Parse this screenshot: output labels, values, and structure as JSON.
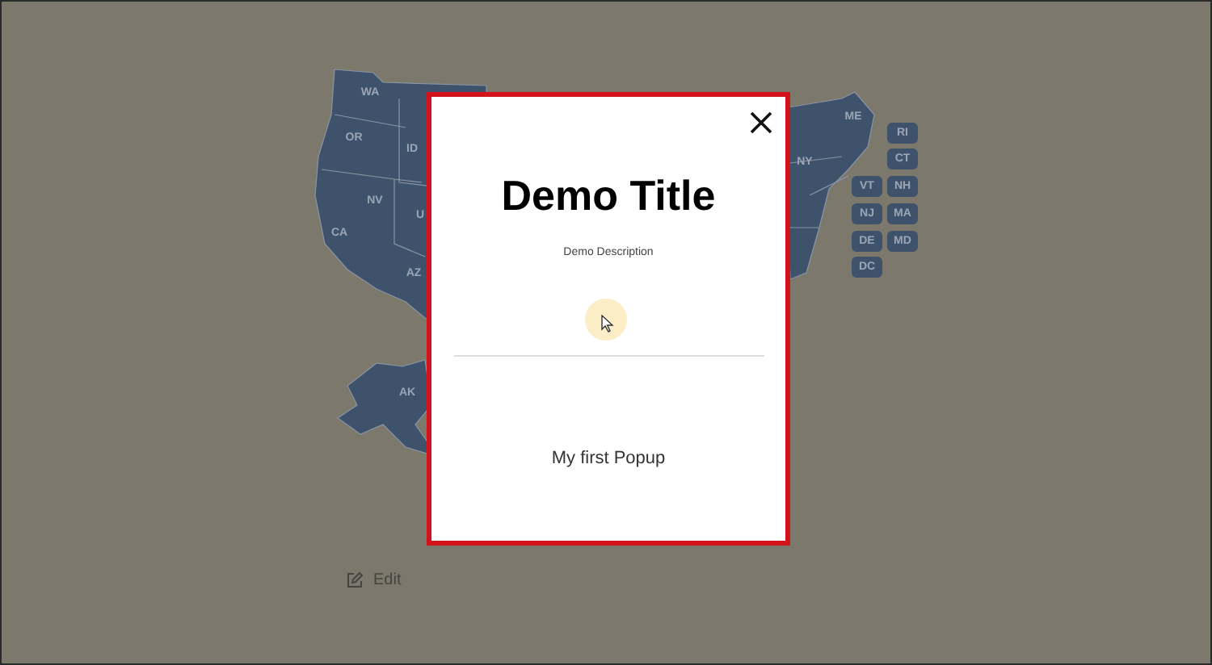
{
  "map": {
    "state_labels": [
      {
        "label": "WA"
      },
      {
        "label": "OR"
      },
      {
        "label": "ID"
      },
      {
        "label": "NV"
      },
      {
        "label": "CA"
      },
      {
        "label": "U"
      },
      {
        "label": "AZ"
      },
      {
        "label": "AK"
      },
      {
        "label": "NY"
      },
      {
        "label": "ME"
      }
    ],
    "state_buttons": [
      {
        "label": "RI"
      },
      {
        "label": "CT"
      },
      {
        "label": "VT"
      },
      {
        "label": "NH"
      },
      {
        "label": "NJ"
      },
      {
        "label": "MA"
      },
      {
        "label": "DE"
      },
      {
        "label": "MD"
      },
      {
        "label": "DC"
      }
    ]
  },
  "popup": {
    "title": "Demo Title",
    "description": "Demo Description",
    "heading": "My first Popup"
  },
  "edit_link": {
    "label": "Edit"
  }
}
